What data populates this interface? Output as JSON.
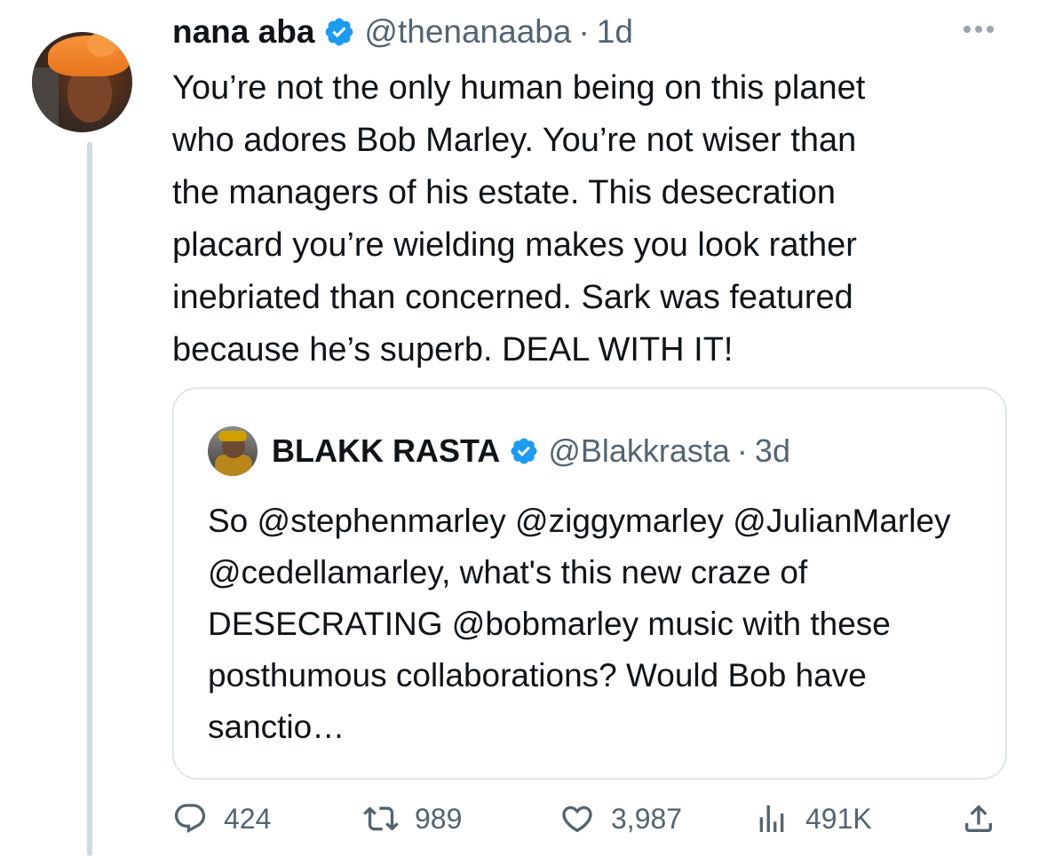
{
  "tweet": {
    "author_name": "nana aba",
    "author_handle": "@thenanaaba",
    "separator": "·",
    "time": "1d",
    "text": "You’re not the only human being on this planet\nwho adores Bob Marley. You’re not wiser than\nthe managers of his estate. This desecration\nplacard you’re wielding makes you look rather\ninebriated than concerned. Sark was featured\nbecause he’s superb. DEAL WITH IT!"
  },
  "quoted": {
    "author_name": "BLAKK RASTA",
    "author_handle": "@Blakkrasta",
    "separator": "·",
    "time": "3d",
    "text": "So @stephenmarley @ziggymarley @JulianMarley @cedellamarley, what's this new craze of DESECRATING @bobmarley music with these posthumous collaborations? Would Bob have sanctio…"
  },
  "actions": {
    "replies": "424",
    "retweets": "989",
    "likes": "3,987",
    "views": "491K"
  },
  "colors": {
    "verified": "#1d9bf0",
    "muted_text": "#536471",
    "thread_line": "#cfd9de",
    "border": "#dfe6ea"
  },
  "icons": [
    "verified-badge-icon",
    "more-options-icon",
    "reply-icon",
    "retweet-icon",
    "like-icon",
    "views-icon",
    "share-icon"
  ]
}
